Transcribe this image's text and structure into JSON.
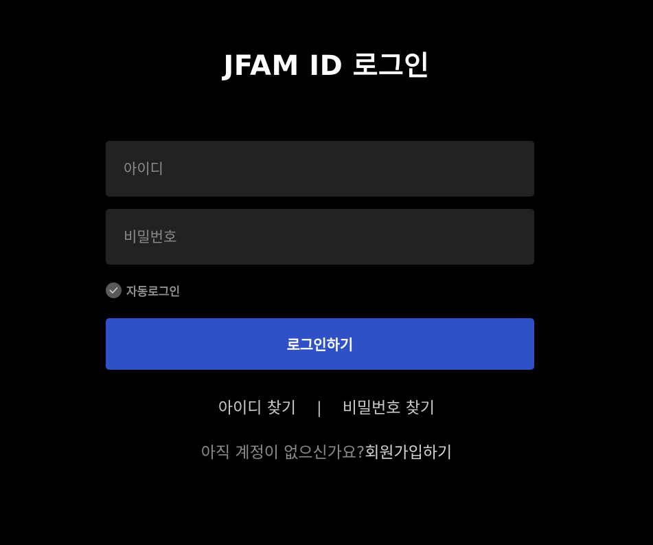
{
  "page": {
    "title": "JFAM ID 로그인"
  },
  "form": {
    "id_field": {
      "placeholder": "아이디",
      "value": ""
    },
    "password_field": {
      "placeholder": "비밀번호",
      "value": ""
    },
    "auto_login": {
      "label": "자동로그인",
      "checked": false,
      "icon": "check-icon"
    },
    "login_button": {
      "label": "로그인하기"
    }
  },
  "links": {
    "find_id": "아이디 찾기",
    "separator": "|",
    "find_password": "비밀번호 찾기"
  },
  "signup": {
    "prompt": "아직 계정이 없으신가요?",
    "link": "회원가입하기"
  },
  "colors": {
    "background": "#000000",
    "field_background": "#222222",
    "accent": "#3050c8",
    "checkbox": "#595959"
  }
}
